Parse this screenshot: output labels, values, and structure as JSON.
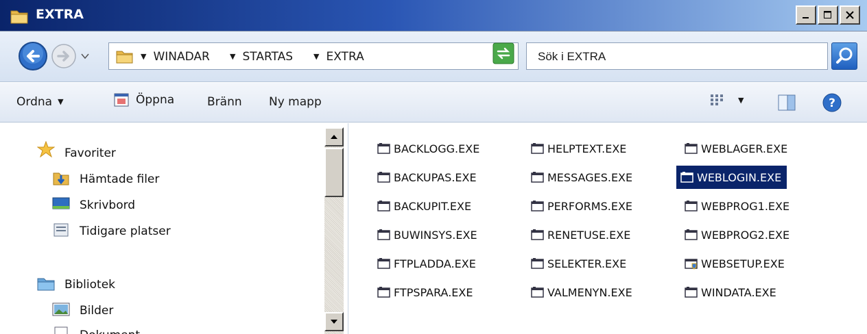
{
  "window": {
    "title": "EXTRA",
    "colors": {
      "title_start": "#0a246a",
      "title_end": "#a6caf0",
      "selection": "#0a246a"
    }
  },
  "address": {
    "crumbs": [
      "WINADAR",
      "STARTAS",
      "EXTRA"
    ],
    "search_placeholder": "Sök i EXTRA"
  },
  "toolbar": {
    "organize_label": "Ordna",
    "open_label": "Öppna",
    "burn_label": "Bränn",
    "new_folder_label": "Ny mapp"
  },
  "navpane": {
    "favorites_label": "Favoriter",
    "downloads_label": "Hämtade filer",
    "desktop_label": "Skrivbord",
    "recent_label": "Tidigare platser",
    "libraries_label": "Bibliotek",
    "pictures_label": "Bilder",
    "documents_label": "Dokument"
  },
  "files": {
    "col1": [
      "BACKLOGG.EXE",
      "BACKUPAS.EXE",
      "BACKUPIT.EXE",
      "BUWINSYS.EXE",
      "FTPLADDA.EXE",
      "FTPSPARA.EXE"
    ],
    "col2": [
      "HELPTEXT.EXE",
      "MESSAGES.EXE",
      "PERFORMS.EXE",
      "RENETUSE.EXE",
      "SELEKTER.EXE",
      "VALMENYN.EXE"
    ],
    "col3": [
      "WEBLAGER.EXE",
      "WEBLOGIN.EXE",
      "WEBPROG1.EXE",
      "WEBPROG2.EXE",
      "WEBSETUP.EXE",
      "WINDATA.EXE"
    ],
    "selected": "WEBLOGIN.EXE"
  }
}
